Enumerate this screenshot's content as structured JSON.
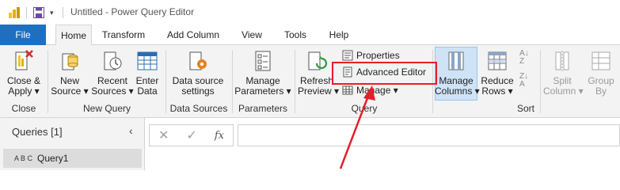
{
  "window": {
    "title": "Untitled - Power Query Editor",
    "qat_dropdown": "▾"
  },
  "tabs": [
    "File",
    "Home",
    "Transform",
    "Add Column",
    "View",
    "Tools",
    "Help"
  ],
  "ribbon": {
    "close_apply": {
      "line1": "Close &",
      "line2": "Apply ▾"
    },
    "new_source": {
      "line1": "New",
      "line2": "Source ▾"
    },
    "recent_sources": {
      "line1": "Recent",
      "line2": "Sources ▾"
    },
    "enter_data": {
      "line1": "Enter",
      "line2": "Data"
    },
    "data_source_settings": {
      "line1": "Data source",
      "line2": "settings"
    },
    "manage_parameters": {
      "line1": "Manage",
      "line2": "Parameters ▾"
    },
    "refresh_preview": {
      "line1": "Refresh",
      "line2": "Preview ▾"
    },
    "properties": "Properties",
    "advanced_editor": "Advanced Editor",
    "manage": "Manage ▾",
    "manage_columns": {
      "line1": "Manage",
      "line2": "Columns ▾"
    },
    "reduce_rows": {
      "line1": "Reduce",
      "line2": "Rows ▾"
    },
    "split_column": {
      "line1": "Split",
      "line2": "Column ▾"
    },
    "group_by": {
      "line1": "Group",
      "line2": "By"
    },
    "groups": {
      "close": "Close",
      "new_query": "New Query",
      "data_sources": "Data Sources",
      "parameters": "Parameters",
      "query": "Query",
      "sort": "Sort"
    }
  },
  "queries_pane": {
    "header": "Queries [1]",
    "collapse": "‹",
    "items": [
      {
        "type_icon": "A B C",
        "name": "Query1"
      }
    ]
  },
  "formula_bar": {
    "cancel": "✕",
    "commit": "✓",
    "fx": "fx",
    "value": ""
  },
  "colors": {
    "file_tab": "#1f6fc0",
    "annotation": "#e3202a",
    "brand": "#f2c811"
  }
}
